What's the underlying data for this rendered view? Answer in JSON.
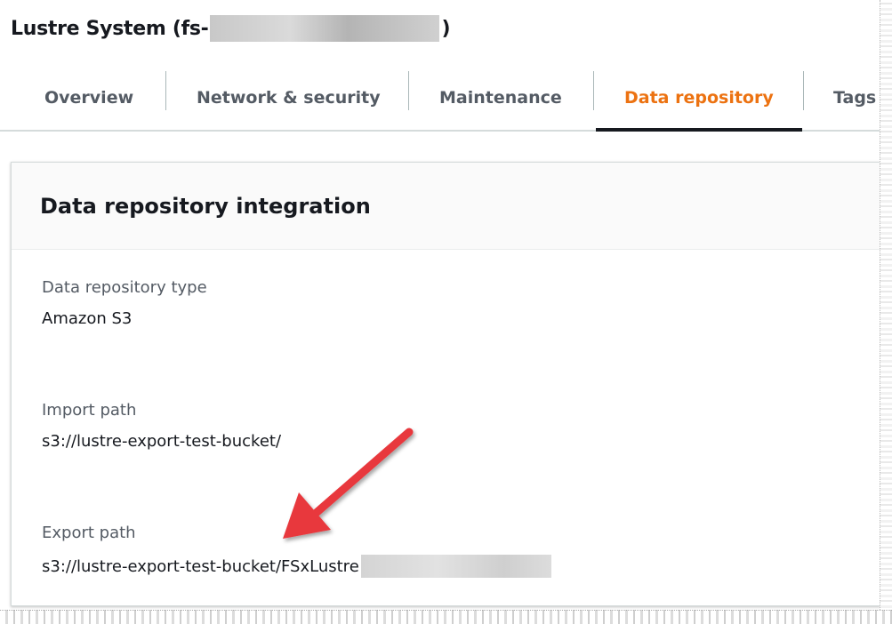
{
  "header": {
    "title_prefix": "Lustre System (fs-",
    "title_suffix": ")"
  },
  "tabs": [
    {
      "label": "Overview",
      "active": false
    },
    {
      "label": "Network & security",
      "active": false
    },
    {
      "label": "Maintenance",
      "active": false
    },
    {
      "label": "Data repository",
      "active": true
    },
    {
      "label": "Tags",
      "active": false
    }
  ],
  "panel": {
    "title": "Data repository integration",
    "fields": [
      {
        "label": "Data repository type",
        "value": "Amazon S3"
      },
      {
        "label": "Import path",
        "value": "s3://lustre-export-test-bucket/"
      },
      {
        "label": "Export path",
        "value": "s3://lustre-export-test-bucket/FSxLustre"
      }
    ]
  },
  "colors": {
    "active_tab": "#ec7211",
    "arrow": "#e8383d",
    "text_primary": "#16191f",
    "text_secondary": "#545b64"
  }
}
